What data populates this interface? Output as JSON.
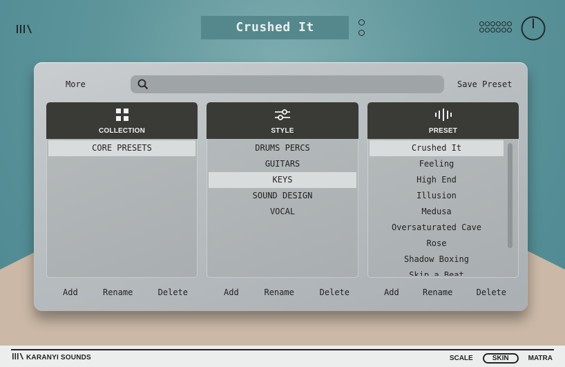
{
  "header": {
    "preset_name": "Crushed It"
  },
  "toolbar": {
    "more_label": "More",
    "search_placeholder": "",
    "save_label": "Save Preset"
  },
  "collection": {
    "title": "COLLECTION",
    "items": [
      "CORE PRESETS"
    ],
    "selected_index": 0,
    "actions": {
      "add": "Add",
      "rename": "Rename",
      "delete": "Delete"
    }
  },
  "style": {
    "title": "STYLE",
    "items": [
      "DRUMS PERCS",
      "GUITARS",
      "KEYS",
      "SOUND DESIGN",
      "VOCAL"
    ],
    "selected_index": 2,
    "actions": {
      "add": "Add",
      "rename": "Rename",
      "delete": "Delete"
    }
  },
  "preset": {
    "title": "PRESET",
    "items": [
      "Crushed It",
      "Feeling",
      "High End",
      "Illusion",
      "Medusa",
      "Oversaturated Cave",
      "Rose",
      "Shadow Boxing",
      "Skip a Beat"
    ],
    "selected_index": 0,
    "actions": {
      "add": "Add",
      "rename": "Rename",
      "delete": "Delete"
    }
  },
  "footer": {
    "brand": "KARANYI SOUNDS",
    "scale_label": "SCALE",
    "skin_label": "SKIN",
    "matra_label": "MATRA"
  },
  "icons": {
    "logo": "library-bars-icon",
    "options": "vertical-dots-icon",
    "grid": "dot-grid-icon",
    "power": "power-icon",
    "search": "search-icon",
    "collection": "grid-squares-icon",
    "style": "sliders-icon",
    "preset": "waveform-icon"
  }
}
